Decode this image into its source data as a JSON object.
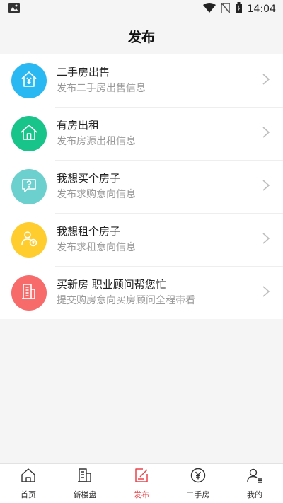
{
  "status_bar": {
    "time": "14:04"
  },
  "header": {
    "title": "发布"
  },
  "items": [
    {
      "title": "二手房出售",
      "subtitle": "发布二手房出售信息",
      "color": "#2ab8f2",
      "icon": "house-yuan-icon"
    },
    {
      "title": "有房出租",
      "subtitle": "发布房源出租信息",
      "color": "#19c48a",
      "icon": "house-icon"
    },
    {
      "title": "我想买个房子",
      "subtitle": "发布求购意向信息",
      "color": "#6cd0cf",
      "icon": "question-chat-icon"
    },
    {
      "title": "我想租个房子",
      "subtitle": "发布求租意向信息",
      "color": "#ffcd2e",
      "icon": "person-rent-icon"
    },
    {
      "title": "买新房 职业顾问帮您忙",
      "subtitle": "提交购房意向买房顾问全程带看",
      "color": "#f76b6b",
      "icon": "building-icon"
    }
  ],
  "bottom_nav": [
    {
      "label": "首页",
      "icon": "home-icon"
    },
    {
      "label": "新楼盘",
      "icon": "building-icon"
    },
    {
      "label": "发布",
      "icon": "publish-icon",
      "active": true
    },
    {
      "label": "二手房",
      "icon": "yuan-icon"
    },
    {
      "label": "我的",
      "icon": "profile-icon"
    }
  ],
  "colors": {
    "accent": "#e8444a"
  }
}
